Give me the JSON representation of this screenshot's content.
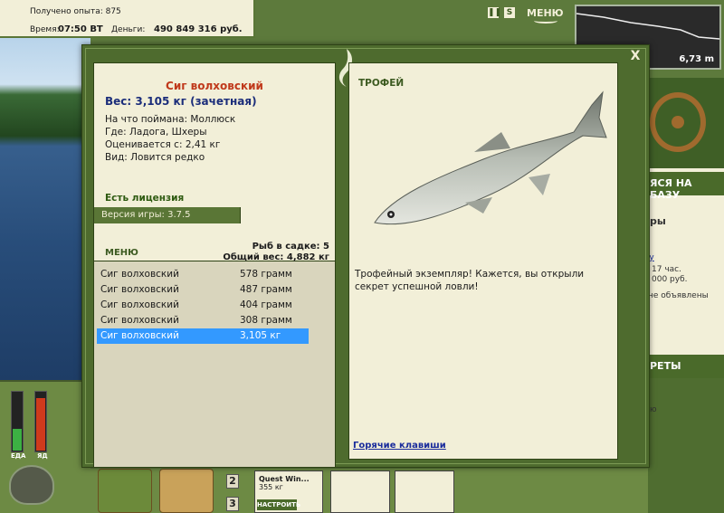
{
  "status": {
    "experience": "Получено опыта: 875",
    "time_label": "Время:",
    "time": "07:50 ВТ",
    "money_label": "Деньги:",
    "money": "490 849 316 руб."
  },
  "topbar": {
    "pause_icon": "pause-icon",
    "settings_icon": "settings-icon",
    "menu_label": "МЕНЮ"
  },
  "depth": {
    "value": "6,73 m"
  },
  "dialog": {
    "close_label": "X",
    "fish": {
      "name": "Сиг волховский",
      "weight": "Вес: 3,105 кг (зачетная)",
      "bait": "На что поймана: Моллюск",
      "location": "Где: Ладога, Шхеры",
      "rated_from": "Оценивается с: 2,41 кг",
      "species_note": "Вид: Ловится редко"
    },
    "license": "Есть лицензия",
    "version": "Версия игры: 3.7.5",
    "menu_label": "МЕНЮ",
    "keepnet_count": "Рыб в садке: 5",
    "keepnet_weight": "Общий вес: 4,882 кг",
    "catch_list": [
      {
        "name": "Сиг волховский",
        "weight": "578 грамм"
      },
      {
        "name": "Сиг волховский",
        "weight": "487 грамм"
      },
      {
        "name": "Сиг волховский",
        "weight": "404 грамм"
      },
      {
        "name": "Сиг волховский",
        "weight": "308 грамм"
      },
      {
        "name": "Сиг волховский",
        "weight": "3,105 кг"
      }
    ],
    "selected_index": 4,
    "trophy_title": "ТРОФЕЙ",
    "trophy_text": "Трофейный экземпляр! Кажется, вы открыли секрет успешной ловли!",
    "hotkeys_label": "Горячие клавиши"
  },
  "right_side": {
    "base_label": "ЯСЯ НА БАЗУ",
    "panel_title": "ры",
    "hours": "17 час.",
    "price": "000 руб.",
    "announce": "не объявлены",
    "link": "ку",
    "secrets_label": "РЕТЫ",
    "misc": "ю"
  },
  "gauges": {
    "food_label": "ЕДА",
    "poison_label": "ЯД",
    "food_level": 0.35,
    "poison_level": 0.85
  },
  "toolbar": {
    "slot2": "2",
    "slot3": "3",
    "quest_title": "Quest Win...",
    "quest_weight": "355 кг",
    "quest_button": "НАСТРОИТЬ"
  },
  "colors": {
    "accent_green": "#4e6b2e",
    "card_bg": "#f2efd8",
    "fish_name": "#c0391b",
    "weight_text": "#1b2d7a",
    "selection": "#3399ff"
  }
}
